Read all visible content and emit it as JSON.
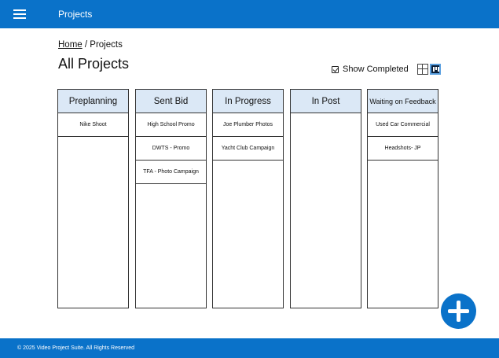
{
  "header": {
    "title": "Projects",
    "menu_icon": "hamburger-menu-icon"
  },
  "breadcrumb": {
    "home": "Home",
    "separator": " / ",
    "current": "Projects"
  },
  "page": {
    "title": "All Projects"
  },
  "toolbar": {
    "show_completed_label": "Show Completed",
    "show_completed_checked": true,
    "view_modes": [
      "grid-view-icon",
      "board-view-icon"
    ],
    "active_view": "board"
  },
  "board": {
    "columns": [
      {
        "title": "Preplanning",
        "cards": [
          "Nike Shoot"
        ]
      },
      {
        "title": "Sent Bid",
        "cards": [
          "High School Promo",
          "DWTS - Promo",
          "TFA - Photo Campaign"
        ]
      },
      {
        "title": "In Progress",
        "cards": [
          "Joe Plumber Photos",
          "Yacht Club Campaign"
        ]
      },
      {
        "title": "In Post",
        "cards": []
      },
      {
        "title": "Waiting on Feedback",
        "cards": [
          "Used Car Commercial",
          "Headshots- JP"
        ]
      }
    ]
  },
  "footer": {
    "copyright": "© 2025 Video Project Suite.  All Rights Reserved"
  },
  "colors": {
    "primary": "#0a72c9",
    "column_header": "#dbe8f6"
  }
}
